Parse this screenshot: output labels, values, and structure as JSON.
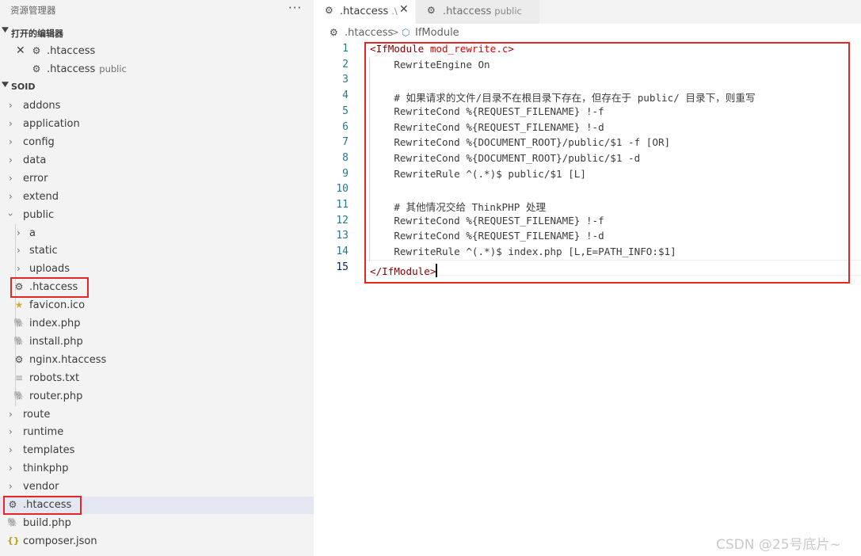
{
  "explorer": {
    "title": "资源管理器",
    "more": "···",
    "open_editors_label": "打开的编辑器",
    "open_editors": [
      {
        "name": ".htaccess",
        "desc": "",
        "close": "✕"
      },
      {
        "name": ".htaccess",
        "desc": "public"
      }
    ],
    "workspace_label": "SOID",
    "tree": [
      {
        "name": "addons"
      },
      {
        "name": "application"
      },
      {
        "name": "config"
      },
      {
        "name": "data"
      },
      {
        "name": "error"
      },
      {
        "name": "extend"
      },
      {
        "name": "public"
      },
      {
        "name": "a"
      },
      {
        "name": "static"
      },
      {
        "name": "uploads"
      },
      {
        "name": ".htaccess"
      },
      {
        "name": "favicon.ico"
      },
      {
        "name": "index.php"
      },
      {
        "name": "install.php"
      },
      {
        "name": "nginx.htaccess"
      },
      {
        "name": "robots.txt"
      },
      {
        "name": "router.php"
      },
      {
        "name": "route"
      },
      {
        "name": "runtime"
      },
      {
        "name": "templates"
      },
      {
        "name": "thinkphp"
      },
      {
        "name": "vendor"
      },
      {
        "name": ".htaccess"
      },
      {
        "name": "build.php"
      },
      {
        "name": "composer.json"
      }
    ]
  },
  "tabs": [
    {
      "name": ".htaccess",
      "desc": ".\\",
      "close": "✕"
    },
    {
      "name": ".htaccess",
      "desc": "public"
    }
  ],
  "breadcrumb": {
    "file": ".htaccess",
    "separator": ">",
    "symbol": "IfModule"
  },
  "editor": {
    "lines": [
      {
        "n": "1",
        "parts": [
          {
            "t": "<IfModule ",
            "c": "tag"
          },
          {
            "t": "mod_rewrite.c",
            "c": "attr"
          },
          {
            "t": ">",
            "c": "tag"
          }
        ]
      },
      {
        "n": "2",
        "parts": [
          {
            "t": "    RewriteEngine On",
            "c": ""
          }
        ]
      },
      {
        "n": "3",
        "parts": [
          {
            "t": "",
            "c": ""
          }
        ]
      },
      {
        "n": "4",
        "parts": [
          {
            "t": "    # 如果请求的文件/目录不在根目录下存在，但存在于 public/ 目录下，则重写",
            "c": "comment"
          }
        ]
      },
      {
        "n": "5",
        "parts": [
          {
            "t": "    RewriteCond %{REQUEST_FILENAME} !-f",
            "c": ""
          }
        ]
      },
      {
        "n": "6",
        "parts": [
          {
            "t": "    RewriteCond %{REQUEST_FILENAME} !-d",
            "c": ""
          }
        ]
      },
      {
        "n": "7",
        "parts": [
          {
            "t": "    RewriteCond %{DOCUMENT_ROOT}/public/$1 -f [OR]",
            "c": ""
          }
        ]
      },
      {
        "n": "8",
        "parts": [
          {
            "t": "    RewriteCond %{DOCUMENT_ROOT}/public/$1 -d",
            "c": ""
          }
        ]
      },
      {
        "n": "9",
        "parts": [
          {
            "t": "    RewriteRule ^(.*)$ public/$1 [L]",
            "c": ""
          }
        ]
      },
      {
        "n": "10",
        "parts": [
          {
            "t": "",
            "c": ""
          }
        ]
      },
      {
        "n": "11",
        "parts": [
          {
            "t": "    # 其他情况交给 ThinkPHP 处理",
            "c": "comment"
          }
        ]
      },
      {
        "n": "12",
        "parts": [
          {
            "t": "    RewriteCond %{REQUEST_FILENAME} !-f",
            "c": ""
          }
        ]
      },
      {
        "n": "13",
        "parts": [
          {
            "t": "    RewriteCond %{REQUEST_FILENAME} !-d",
            "c": ""
          }
        ]
      },
      {
        "n": "14",
        "parts": [
          {
            "t": "    RewriteRule ^(.*)$ index.php [L,E=PATH_INFO:$1]",
            "c": ""
          }
        ]
      },
      {
        "n": "15",
        "parts": [
          {
            "t": "</IfModule>",
            "c": "tag"
          }
        ]
      }
    ]
  },
  "watermark": "CSDN @25号底片~",
  "colors": {
    "highlight_box": "#e32626",
    "selected_row": "#e4e6f1",
    "line_number": "#237893",
    "tag": "#800000",
    "attribute": "#e50000"
  }
}
